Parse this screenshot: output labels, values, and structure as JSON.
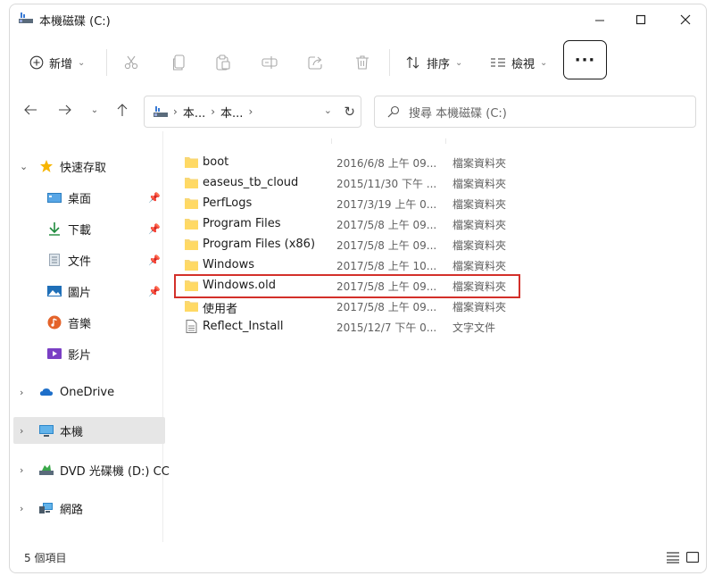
{
  "window": {
    "title": "本機磁碟 (C:)"
  },
  "toolbar": {
    "new_label": "新增",
    "sort_label": "排序",
    "view_label": "檢視",
    "more_label": "···"
  },
  "address": {
    "segments": [
      "本...",
      "本..."
    ],
    "search_placeholder": "搜尋 本機磁碟 (C:)"
  },
  "sidebar": {
    "quick_access": "快速存取",
    "items": [
      {
        "label": "桌面",
        "icon": "desktop-icon",
        "pinned": true
      },
      {
        "label": "下載",
        "icon": "download-icon",
        "pinned": true
      },
      {
        "label": "文件",
        "icon": "document-icon",
        "pinned": true
      },
      {
        "label": "圖片",
        "icon": "picture-icon",
        "pinned": true
      },
      {
        "label": "音樂",
        "icon": "music-icon",
        "pinned": false
      },
      {
        "label": "影片",
        "icon": "video-icon",
        "pinned": false
      }
    ],
    "onedrive": "OneDrive",
    "this_pc": "本機",
    "dvd": "DVD 光碟機 (D:) CC",
    "network": "網路"
  },
  "files": [
    {
      "name": "boot",
      "date": "2016/6/8 上午 09...",
      "type": "檔案資料夾",
      "kind": "folder"
    },
    {
      "name": "easeus_tb_cloud",
      "date": "2015/11/30 下午 ...",
      "type": "檔案資料夾",
      "kind": "folder"
    },
    {
      "name": "PerfLogs",
      "date": "2017/3/19 上午 0...",
      "type": "檔案資料夾",
      "kind": "folder"
    },
    {
      "name": "Program Files",
      "date": "2017/5/8 上午 09...",
      "type": "檔案資料夾",
      "kind": "folder"
    },
    {
      "name": "Program Files (x86)",
      "date": "2017/5/8 上午 09...",
      "type": "檔案資料夾",
      "kind": "folder"
    },
    {
      "name": "Windows",
      "date": "2017/5/8 上午 10...",
      "type": "檔案資料夾",
      "kind": "folder"
    },
    {
      "name": "Windows.old",
      "date": "2017/5/8 上午 09...",
      "type": "檔案資料夾",
      "kind": "folder"
    },
    {
      "name": "使用者",
      "date": "2017/5/8 上午 09...",
      "type": "檔案資料夾",
      "kind": "folder"
    },
    {
      "name": "Reflect_Install",
      "date": "2015/12/7 下午 0...",
      "type": "文字文件",
      "kind": "text"
    }
  ],
  "status": {
    "item_count": "5 個項目"
  },
  "colors": {
    "folder": "#f8d775",
    "highlight": "#d3302a",
    "selected_bg": "#e6e6e6"
  }
}
